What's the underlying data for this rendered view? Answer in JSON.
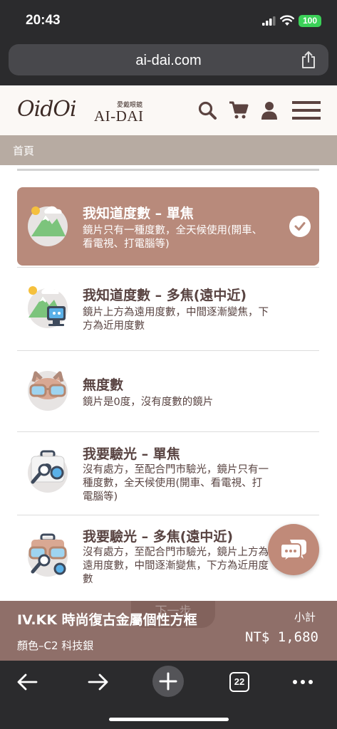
{
  "status_bar": {
    "time": "20:43",
    "battery": "100"
  },
  "browser": {
    "url": "ai-dai.com",
    "tab_count": "22"
  },
  "header": {
    "logo_script": "OidOi",
    "logo_cn": "愛戴眼鏡",
    "logo_brand": "AI-DAI"
  },
  "breadcrumb": {
    "home": "首頁"
  },
  "options": [
    {
      "title": "我知道度數 – 單焦",
      "desc": "鏡片只有一種度數，全天候使用(開車、看電視、打電腦等)",
      "selected": true
    },
    {
      "title": "我知道度數 – 多焦(遠中近)",
      "desc": "鏡片上方為遠用度數，中間逐漸變焦，下方為近用度數",
      "selected": false
    },
    {
      "title": "無度數",
      "desc": "鏡片是0度，沒有度數的鏡片",
      "selected": false
    },
    {
      "title": "我要驗光 – 單焦",
      "desc": "沒有處方，至配合門市驗光，鏡片只有一種度數，全天候使用(開車、看電視、打電腦等)",
      "selected": false
    },
    {
      "title": "我要驗光 – 多焦(遠中近)",
      "desc": "沒有處方，至配合門市驗光，鏡片上方為遠用度數，中間逐漸變焦，下方為近用度數",
      "selected": false
    }
  ],
  "footer": {
    "product_name": "IV.KK 時尚復古金屬個性方框",
    "variant": "顏色–C2 科技銀",
    "subtotal_label": "小計",
    "price": "NT$ 1,680",
    "next_label": "下一步"
  },
  "colors": {
    "accent": "#b88a7b",
    "footer": "#8f6f69",
    "breadcrumb": "#b7aba2",
    "text": "#594442"
  }
}
